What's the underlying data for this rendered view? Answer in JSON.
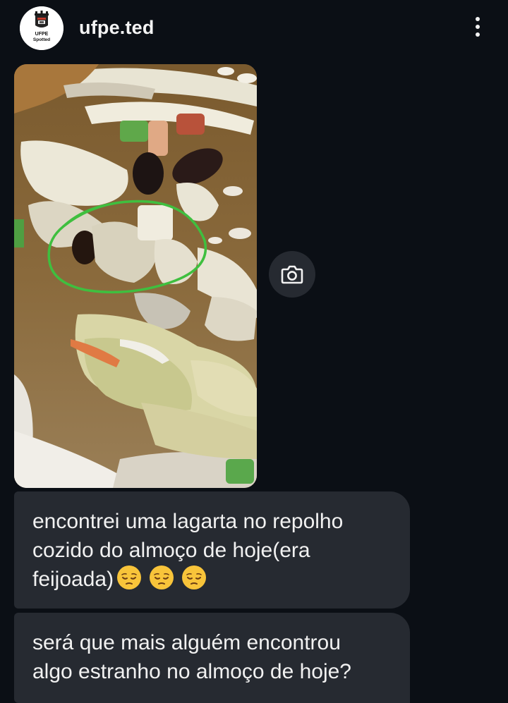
{
  "header": {
    "username": "ufpe.ted",
    "avatar": {
      "icon": "ufpe-spotted-logo",
      "logo_text_top": "UFPE",
      "logo_text_bottom": "Spotted"
    },
    "more_icon": "vertical-ellipsis-icon"
  },
  "photo": {
    "description_icon": "food-photo",
    "annotation_color": "#3fbf3f"
  },
  "camera_button": {
    "icon": "camera-icon"
  },
  "messages": [
    {
      "lines": [
        "encontrei uma lagarta no repolho",
        "cozido do almoço de hoje(era",
        "feijoada)"
      ],
      "emojis": [
        "pensive-face-emoji",
        "pensive-face-emoji",
        "pensive-face-emoji"
      ]
    },
    {
      "lines": [
        "será que mais alguém encontrou",
        "algo estranho no almoço de hoje?"
      ]
    }
  ],
  "colors": {
    "background": "#0b0f15",
    "bubble": "#262a31",
    "text": "#f1f1f1"
  }
}
